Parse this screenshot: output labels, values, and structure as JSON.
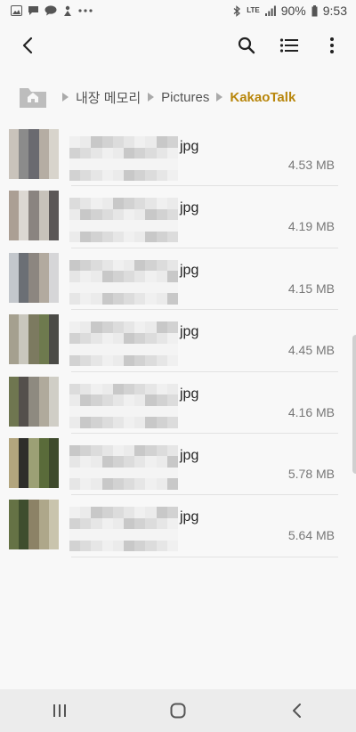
{
  "status_bar": {
    "left_icons": [
      "gallery-icon",
      "chat-icon",
      "kakaotalk-icon",
      "notification-icon",
      "more-dots-icon"
    ],
    "network": "LTE",
    "battery": "90%",
    "time": "9:53"
  },
  "toolbar": {
    "back_icon": "back-arrow-icon",
    "search_icon": "search-icon",
    "view_icon": "list-view-icon",
    "more_icon": "more-vertical-icon"
  },
  "breadcrumb": {
    "home_icon": "home-folder-icon",
    "items": [
      "내장 메모리",
      "Pictures"
    ],
    "current": "KakaoTalk",
    "accent_color": "#b8860b"
  },
  "files": [
    {
      "ext": "jpg",
      "size": "4.53 MB"
    },
    {
      "ext": "jpg",
      "size": "4.19 MB"
    },
    {
      "ext": "jpg",
      "size": "4.15 MB"
    },
    {
      "ext": "jpg",
      "size": "4.45 MB"
    },
    {
      "ext": "jpg",
      "size": "4.16 MB"
    },
    {
      "ext": "jpg",
      "size": "5.78 MB"
    },
    {
      "ext": "jpg",
      "size": "5.64 MB"
    }
  ],
  "nav_bar": {
    "recents_icon": "recents-icon",
    "home_icon": "home-button-icon",
    "back_icon": "nav-back-icon"
  }
}
